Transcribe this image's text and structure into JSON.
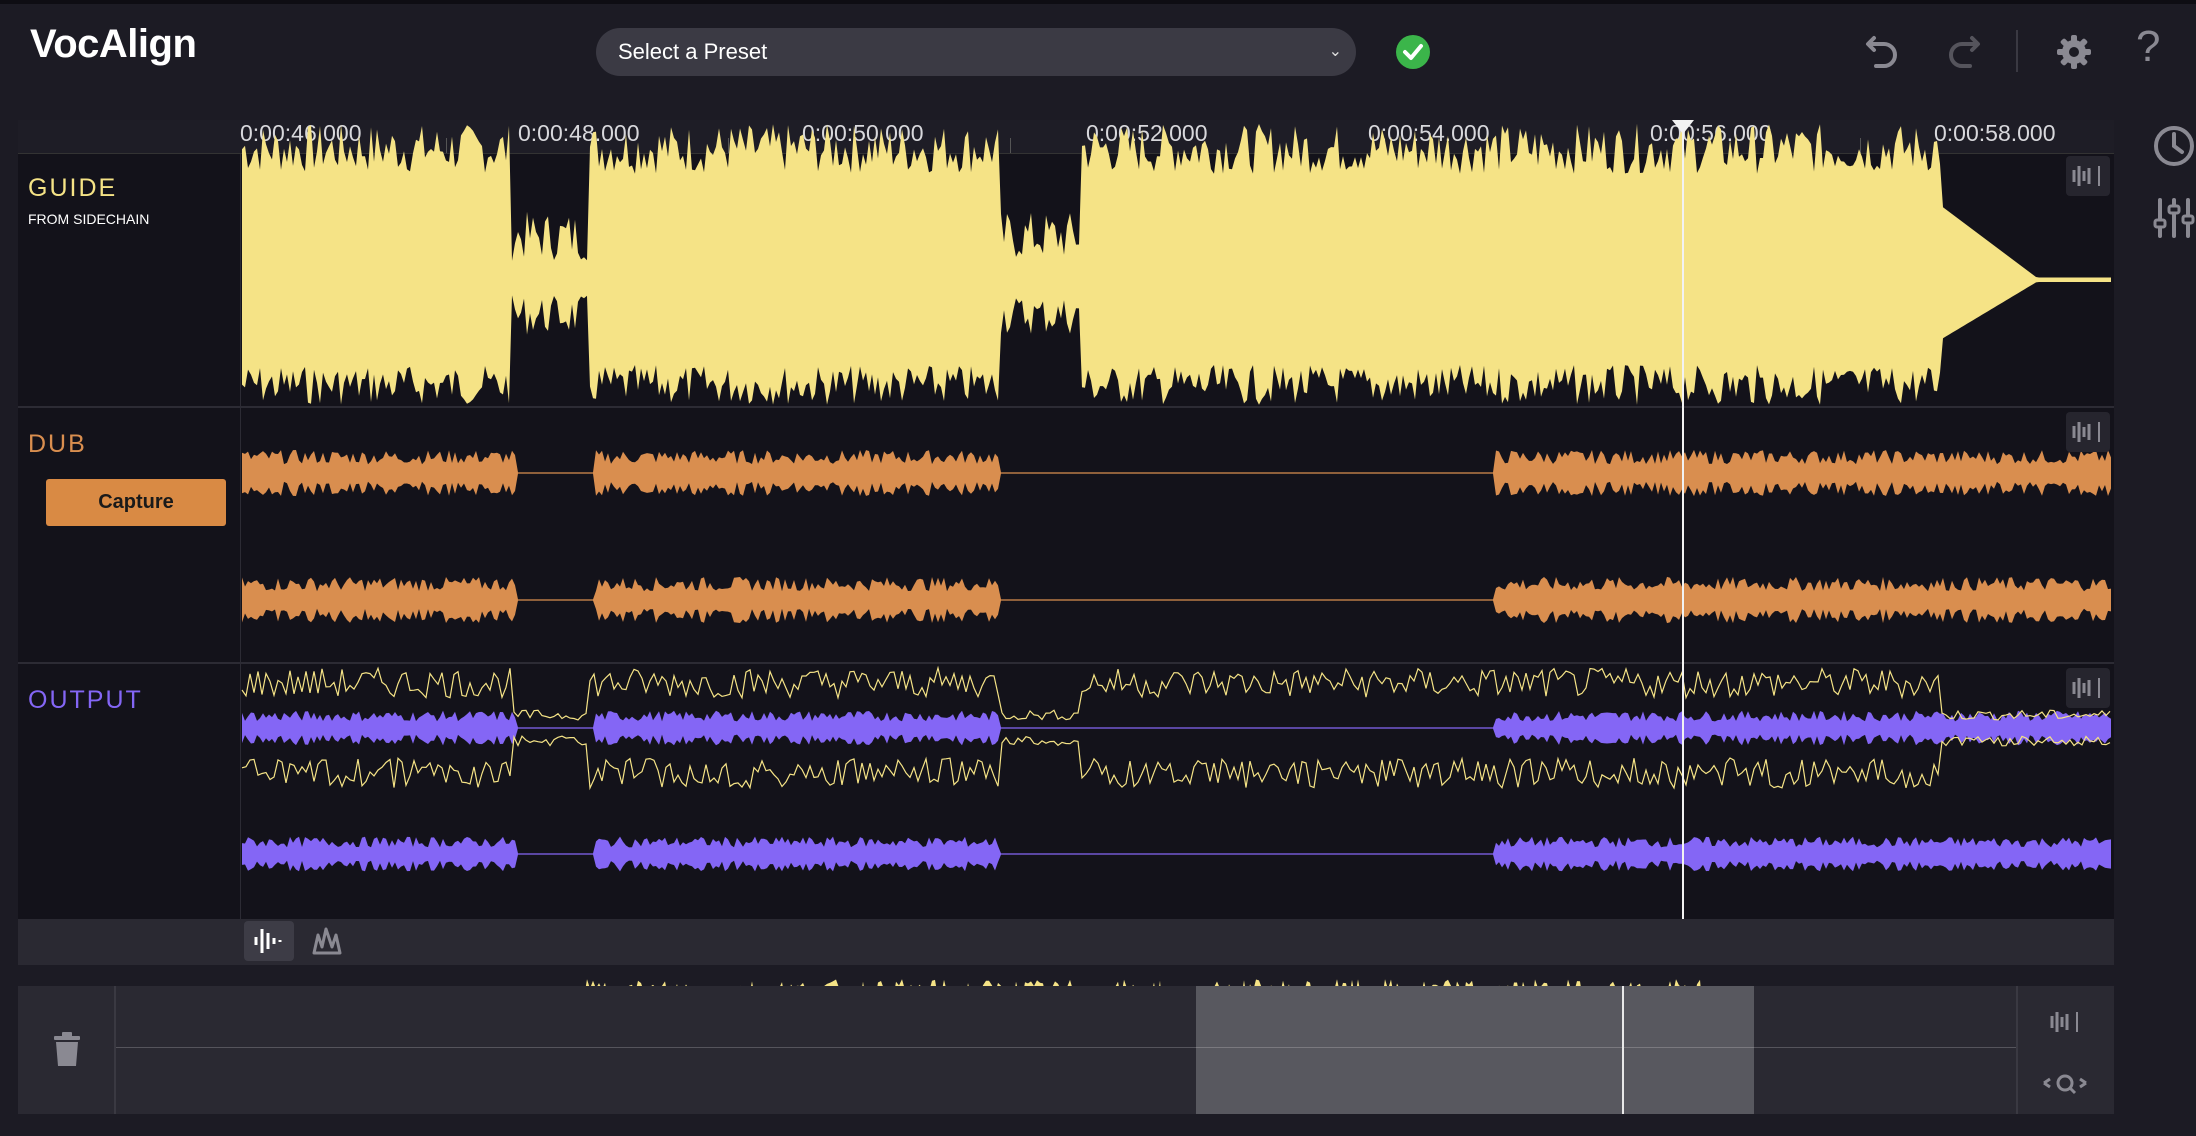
{
  "app": {
    "title": "VocAlign"
  },
  "toolbar": {
    "preset_placeholder": "Select a Preset",
    "status_icon": "check-circle-icon",
    "help_label": "?"
  },
  "ruler": {
    "ticks": [
      "0:00:46.000",
      "0:00:48.000",
      "0:00:50.000",
      "0:00:52.000",
      "0:00:54.000",
      "0:00:56.000",
      "0:00:58.000"
    ]
  },
  "lanes": {
    "guide": {
      "title": "GUIDE",
      "subtitle": "FROM SIDECHAIN",
      "color": "#f5e386"
    },
    "dub": {
      "title": "DUB",
      "capture_label": "Capture",
      "color": "#d98e4f"
    },
    "output": {
      "title": "OUTPUT",
      "color": "#8466f5"
    }
  },
  "colors": {
    "background": "#13121a",
    "panel": "#1c1b24",
    "accent_button": "#d98a44"
  }
}
